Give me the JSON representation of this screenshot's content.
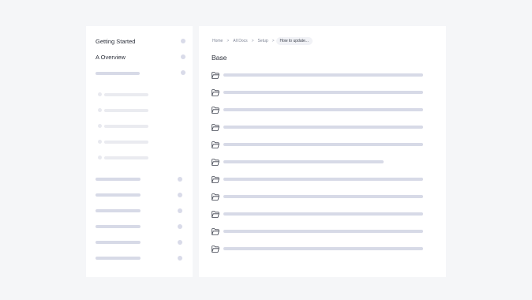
{
  "sidebar": {
    "items": [
      {
        "label": "Getting Started"
      },
      {
        "label": "A Overview"
      }
    ]
  },
  "breadcrumb": {
    "items": [
      "Home",
      "All Docs",
      "Setup",
      "How to update..."
    ],
    "separator": ">"
  },
  "main": {
    "title": "Base"
  },
  "colors": {
    "background": "#f5f6f8",
    "panel": "#ffffff",
    "skeleton": "#d7dae7",
    "skeleton_light": "#eaebf0",
    "text": "#2b2f3a"
  },
  "icons": {
    "file_row": "folder-icon",
    "nav_marker": "dot-icon"
  }
}
